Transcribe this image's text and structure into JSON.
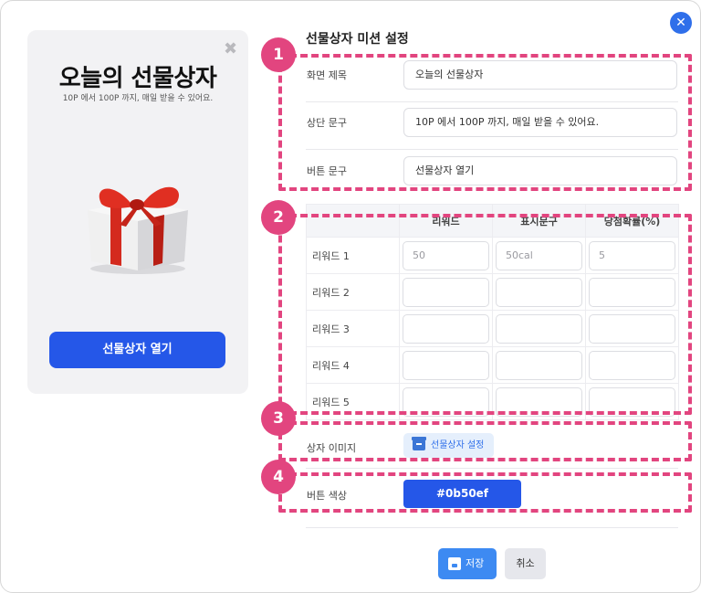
{
  "preview": {
    "title": "오늘의 선물상자",
    "subtitle": "10P 에서 100P 까지, 매일 받을 수 있어요.",
    "open_button": "선물상자 열기"
  },
  "settings": {
    "section_title": "선물상자 미션 설정",
    "fields": [
      {
        "label": "화면 제목",
        "value": "오늘의 선물상자"
      },
      {
        "label": "상단 문구",
        "value": "10P 에서 100P 까지, 매일 받을 수 있어요."
      },
      {
        "label": "버튼 문구",
        "value": "선물상자 열기"
      }
    ],
    "reward_table": {
      "headers": [
        "",
        "리워드",
        "표시문구",
        "당첨확률(%)"
      ],
      "rows": [
        {
          "label": "리워드 1",
          "reward": "50",
          "display": "50cal",
          "prob": "5"
        },
        {
          "label": "리워드 2",
          "reward": "",
          "display": "",
          "prob": ""
        },
        {
          "label": "리워드 3",
          "reward": "",
          "display": "",
          "prob": ""
        },
        {
          "label": "리워드 4",
          "reward": "",
          "display": "",
          "prob": ""
        },
        {
          "label": "리워드 5",
          "reward": "",
          "display": "",
          "prob": ""
        }
      ]
    },
    "box_image": {
      "label": "상자 이미지",
      "button": "선물상자 설정"
    },
    "button_color": {
      "label": "버튼 색상",
      "value": "#0b50ef"
    }
  },
  "actions": {
    "save": "저장",
    "cancel": "취소"
  },
  "annotations": [
    "1",
    "2",
    "3",
    "4"
  ],
  "colors": {
    "accent": "#2557e8",
    "annotation": "#e2457f",
    "save": "#3d8af2"
  }
}
